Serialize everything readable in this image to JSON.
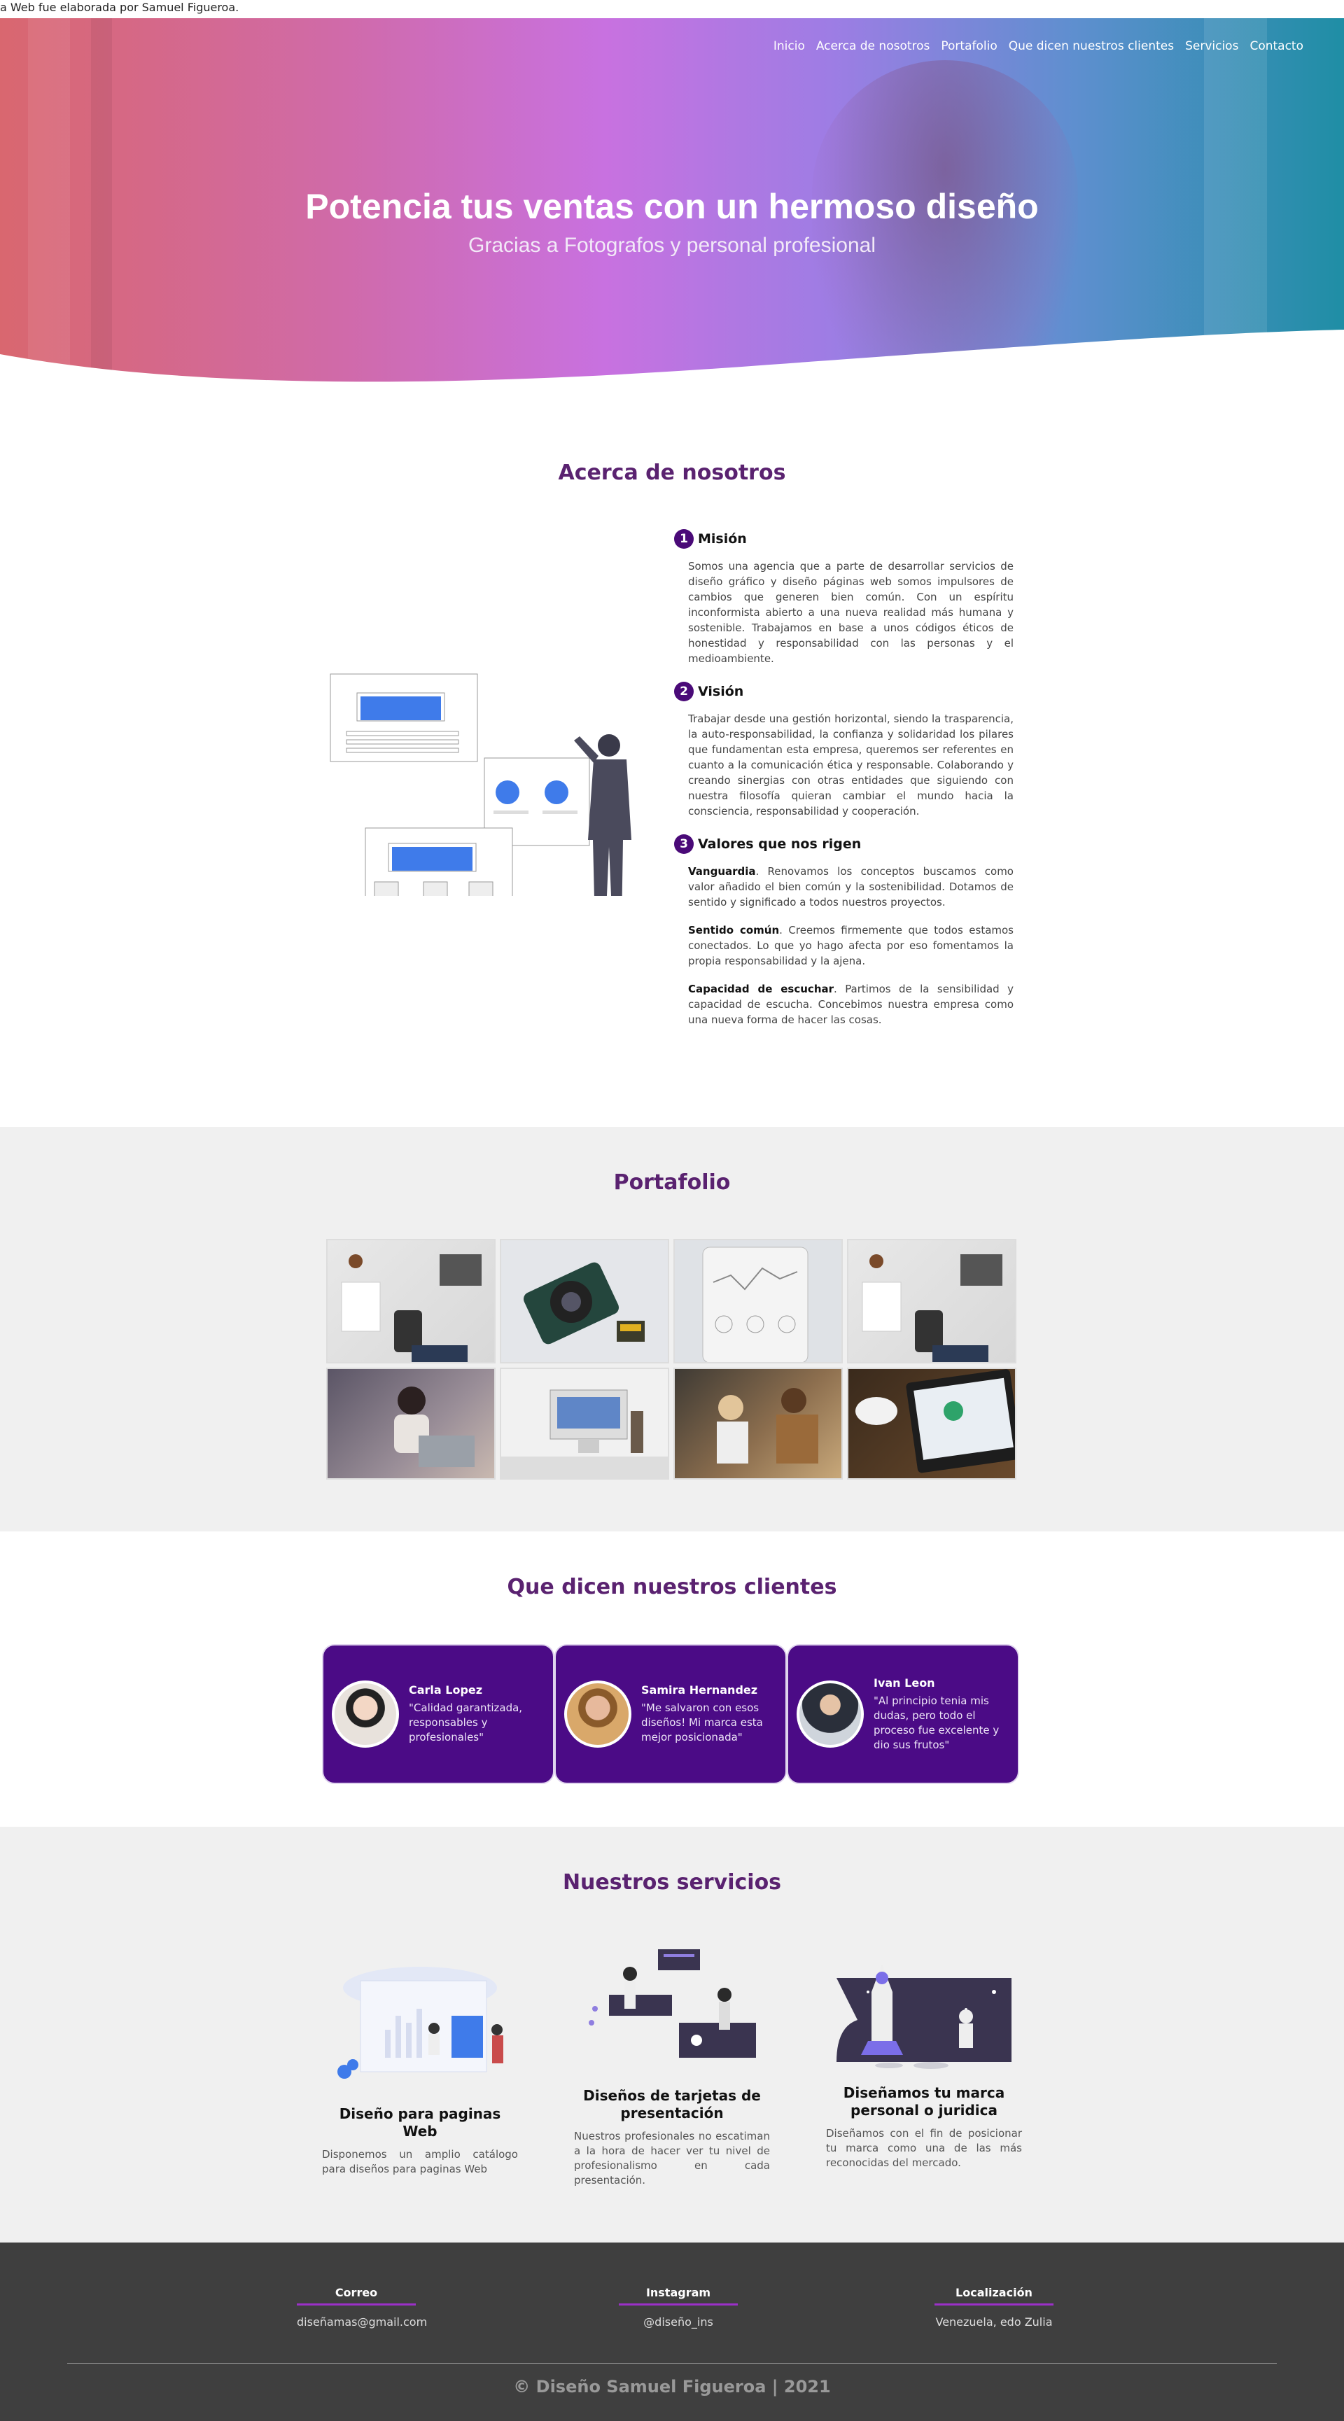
{
  "marquee": "a Web fue elaborada por Samuel Figueroa.",
  "nav": {
    "items": [
      "Inicio",
      "Acerca de nosotros",
      "Portafolio",
      "Que dicen nuestros clientes",
      "Servicios",
      "Contacto"
    ]
  },
  "hero": {
    "title": "Potencia tus ventas con un hermoso diseño",
    "subtitle": "Gracias a Fotografos y personal profesional"
  },
  "about": {
    "title": "Acerca de nosotros",
    "items": [
      {
        "num": "1",
        "heading": "Misión",
        "text": "Somos una agencia que a parte de desarrollar servicios de diseño gráfico y diseño páginas web somos impulsores de cambios que generen bien común. Con un espíritu inconformista abierto a una nueva realidad más humana y sostenible. Trabajamos en base a unos códigos éticos de honestidad y responsabilidad con las personas y el medioambiente."
      },
      {
        "num": "2",
        "heading": "Visión",
        "text": "Trabajar desde una gestión horizontal, siendo la trasparencia, la auto-responsabilidad, la confianza y solidaridad los pilares que fundamentan esta empresa, queremos ser referentes en cuanto a la comunicación ética y responsable. Colaborando y creando sinergias con otras entidades que siguiendo con nuestra filosofía quieran cambiar el mundo hacia la consciencia, responsabilidad y cooperación."
      },
      {
        "num": "3",
        "heading": "Valores que nos rigen",
        "values": [
          {
            "term": "Vanguardia",
            "text": ". Renovamos los conceptos buscamos como valor añadido el bien común y la sostenibilidad. Dotamos de sentido y significado a todos nuestros proyectos."
          },
          {
            "term": "Sentido común",
            "text": ". Creemos firmemente que todos estamos conectados. Lo que yo hago afecta por eso fomentamos la propia responsabilidad y la ajena."
          },
          {
            "term": "Capacidad de escuchar",
            "text": ". Partimos de la sensibilidad y capacidad de escucha. Concebimos nuestra empresa como una nueva forma de hacer las cosas."
          }
        ]
      }
    ]
  },
  "portfolio": {
    "title": "Portafolio"
  },
  "clients": {
    "title": "Que dicen nuestros clientes",
    "items": [
      {
        "name": "Carla Lopez",
        "quote": "\"Calidad garantizada, responsables y profesionales\""
      },
      {
        "name": "Samira Hernandez",
        "quote": "\"Me salvaron con esos diseños! Mi marca esta mejor posicionada\""
      },
      {
        "name": "Ivan Leon",
        "quote": "\"Al principio tenia mis dudas, pero todo el proceso fue excelente y dio sus frutos\""
      }
    ]
  },
  "services": {
    "title": "Nuestros servicios",
    "items": [
      {
        "title": "Diseño para paginas Web",
        "text": "Disponemos un amplio catálogo para diseños para paginas Web"
      },
      {
        "title": "Diseños de tarjetas de presentación",
        "text": "Nuestros profesionales no escatiman a la hora de hacer ver tu nivel de profesionalismo en cada presentación."
      },
      {
        "title": "Diseñamos tu marca personal o juridica",
        "text": "Diseñamos con el fin de posicionar tu marca como una de las más reconocidas del mercado."
      }
    ]
  },
  "footer": {
    "email_label": "Correo",
    "email": "diseñamas@gmail.com",
    "ig_label": "Instagram",
    "ig": "@diseño_ins",
    "loc_label": "Localización",
    "loc": "Venezuela, edo Zulia",
    "copyright": "© Diseño Samuel Figueroa | 2021"
  },
  "colors": {
    "accent": "#4b0b86",
    "heading": "#5a2270",
    "footer_bg": "#3f3f3f",
    "blue": "#3f7bea"
  }
}
